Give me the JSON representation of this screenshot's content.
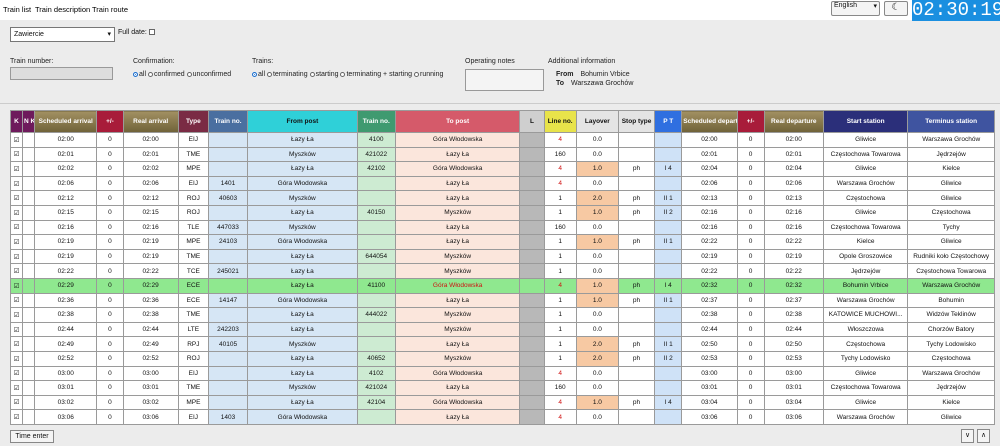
{
  "tabs": [
    "Train list",
    "Train description",
    "Train route"
  ],
  "language": "English",
  "clock": "02:30:19",
  "station": "Zawiercie",
  "full_date_label": "Full date:",
  "train_number_label": "Train number:",
  "confirmation": {
    "label": "Confirmation:",
    "options": [
      "all",
      "confirmed",
      "unconfirmed"
    ],
    "selected": "all"
  },
  "trains_filter": {
    "label": "Trains:",
    "options": [
      "all",
      "terminating",
      "starting",
      "terminating + starting",
      "running"
    ],
    "selected": "all"
  },
  "operating_notes_label": "Operating notes",
  "additional_info": {
    "label": "Additional information",
    "from_label": "From",
    "from_value": "Bohumin Vrbice",
    "to_label": "To",
    "to_value": "Warszawa Grochów"
  },
  "table": {
    "headers": {
      "k": "K",
      "nk": "N K",
      "sched_arr": "Scheduled arrival",
      "delay": "+/-",
      "real_arr": "Real arrival",
      "type": "Type",
      "train_no": "Train no.",
      "from_post": "From post",
      "train_no2": "Train no.",
      "to_post": "To post",
      "l": "L",
      "line": "Line no.",
      "layover": "Layover",
      "stop_type": "Stop type",
      "pt": "P T",
      "sched_dep": "Scheduled departure",
      "delay2": "+/-",
      "real_dep": "Real departure",
      "start": "Start station",
      "term": "Terminus station"
    },
    "rows": [
      {
        "k": "☑",
        "sa": "02:00",
        "d1": "0",
        "ra": "02:00",
        "type": "EIJ",
        "tn": "",
        "from": "Łazy Ła",
        "tn2": "4100",
        "to": "Góra Włodowska",
        "line": "4",
        "lay": "0.0",
        "stop": "",
        "pt": "",
        "sd": "02:00",
        "d2": "0",
        "rd": "02:00",
        "start": "Gliwice",
        "term": "Warszawa Grochów"
      },
      {
        "k": "☑",
        "sa": "02:01",
        "d1": "0",
        "ra": "02:01",
        "type": "TME",
        "tn": "",
        "from": "Myszków",
        "tn2": "421022",
        "to": "Łazy Ła",
        "line": "160",
        "lay": "0.0",
        "stop": "",
        "pt": "",
        "sd": "02:01",
        "d2": "0",
        "rd": "02:01",
        "start": "Częstochowa Towarowa",
        "term": "Jędrzejów"
      },
      {
        "k": "☑",
        "sa": "02:02",
        "d1": "0",
        "ra": "02:02",
        "type": "MPE",
        "tn": "",
        "from": "Łazy Ła",
        "tn2": "42102",
        "to": "Góra Włodowska",
        "line": "4",
        "lay": "1.0",
        "stop": "ph",
        "pt": "I 4",
        "sd": "02:04",
        "d2": "0",
        "rd": "02:04",
        "start": "Gliwice",
        "term": "Kielce"
      },
      {
        "k": "☑",
        "sa": "02:06",
        "d1": "0",
        "ra": "02:06",
        "type": "EIJ",
        "tn": "1401",
        "from": "Góra Włodowska",
        "tn2": "",
        "to": "Łazy Ła",
        "line": "4",
        "lay": "0.0",
        "stop": "",
        "pt": "",
        "sd": "02:06",
        "d2": "0",
        "rd": "02:06",
        "start": "Warszawa Grochów",
        "term": "Gliwice"
      },
      {
        "k": "☑",
        "sa": "02:12",
        "d1": "0",
        "ra": "02:12",
        "type": "ROJ",
        "tn": "40603",
        "from": "Myszków",
        "tn2": "",
        "to": "Łazy Ła",
        "line": "1",
        "lay": "2.0",
        "stop": "ph",
        "pt": "II 1",
        "sd": "02:13",
        "d2": "0",
        "rd": "02:13",
        "start": "Częstochowa",
        "term": "Gliwice"
      },
      {
        "k": "☑",
        "sa": "02:15",
        "d1": "0",
        "ra": "02:15",
        "type": "ROJ",
        "tn": "",
        "from": "Łazy Ła",
        "tn2": "40150",
        "to": "Myszków",
        "line": "1",
        "lay": "1.0",
        "stop": "ph",
        "pt": "II 2",
        "sd": "02:16",
        "d2": "0",
        "rd": "02:16",
        "start": "Gliwice",
        "term": "Częstochowa"
      },
      {
        "k": "☑",
        "sa": "02:16",
        "d1": "0",
        "ra": "02:16",
        "type": "TLE",
        "tn": "447033",
        "from": "Myszków",
        "tn2": "",
        "to": "Łazy Ła",
        "line": "160",
        "lay": "0.0",
        "stop": "",
        "pt": "",
        "sd": "02:16",
        "d2": "0",
        "rd": "02:16",
        "start": "Częstochowa Towarowa",
        "term": "Tychy"
      },
      {
        "k": "☑",
        "sa": "02:19",
        "d1": "0",
        "ra": "02:19",
        "type": "MPE",
        "tn": "24103",
        "from": "Góra Włodowska",
        "tn2": "",
        "to": "Łazy Ła",
        "line": "1",
        "lay": "1.0",
        "stop": "ph",
        "pt": "II 1",
        "sd": "02:22",
        "d2": "0",
        "rd": "02:22",
        "start": "Kielce",
        "term": "Gliwice"
      },
      {
        "k": "☑",
        "sa": "02:19",
        "d1": "0",
        "ra": "02:19",
        "type": "TME",
        "tn": "",
        "from": "Łazy Ła",
        "tn2": "644054",
        "to": "Myszków",
        "line": "1",
        "lay": "0.0",
        "stop": "",
        "pt": "",
        "sd": "02:19",
        "d2": "0",
        "rd": "02:19",
        "start": "Opole Groszowice",
        "term": "Rudniki koło Częstochowy"
      },
      {
        "k": "☑",
        "sa": "02:22",
        "d1": "0",
        "ra": "02:22",
        "type": "TCE",
        "tn": "245021",
        "from": "Łazy Ła",
        "tn2": "",
        "to": "Myszków",
        "line": "1",
        "lay": "0.0",
        "stop": "",
        "pt": "",
        "sd": "02:22",
        "d2": "0",
        "rd": "02:22",
        "start": "Jędrzejów",
        "term": "Częstochowa Towarowa"
      },
      {
        "k": "☑",
        "sa": "02:29",
        "d1": "0",
        "ra": "02:29",
        "type": "ECE",
        "tn": "",
        "from": "Łazy Ła",
        "tn2": "41100",
        "to": "Góra Włodowska",
        "line": "4",
        "lay": "1.0",
        "stop": "ph",
        "pt": "I 4",
        "sd": "02:32",
        "d2": "0",
        "rd": "02:32",
        "start": "Bohumin Vrbice",
        "term": "Warszawa Grochów",
        "active": true
      },
      {
        "k": "☑",
        "sa": "02:36",
        "d1": "0",
        "ra": "02:36",
        "type": "ECE",
        "tn": "14147",
        "from": "Góra Włodowska",
        "tn2": "",
        "to": "Łazy Ła",
        "line": "1",
        "lay": "1.0",
        "stop": "ph",
        "pt": "II 1",
        "sd": "02:37",
        "d2": "0",
        "rd": "02:37",
        "start": "Warszawa Grochów",
        "term": "Bohumin"
      },
      {
        "k": "☑",
        "sa": "02:38",
        "d1": "0",
        "ra": "02:38",
        "type": "TME",
        "tn": "",
        "from": "Łazy Ła",
        "tn2": "444022",
        "to": "Myszków",
        "line": "1",
        "lay": "0.0",
        "stop": "",
        "pt": "",
        "sd": "02:38",
        "d2": "0",
        "rd": "02:38",
        "start": "KATOWICE MUCHOWI...",
        "term": "Widzów Teklinów"
      },
      {
        "k": "☑",
        "sa": "02:44",
        "d1": "0",
        "ra": "02:44",
        "type": "LTE",
        "tn": "242203",
        "from": "Łazy Ła",
        "tn2": "",
        "to": "Myszków",
        "line": "1",
        "lay": "0.0",
        "stop": "",
        "pt": "",
        "sd": "02:44",
        "d2": "0",
        "rd": "02:44",
        "start": "Włoszczowa",
        "term": "Chorzów Batory"
      },
      {
        "k": "☑",
        "sa": "02:49",
        "d1": "0",
        "ra": "02:49",
        "type": "RPJ",
        "tn": "40105",
        "from": "Myszków",
        "tn2": "",
        "to": "Łazy Ła",
        "line": "1",
        "lay": "2.0",
        "stop": "ph",
        "pt": "II 1",
        "sd": "02:50",
        "d2": "0",
        "rd": "02:50",
        "start": "Częstochowa",
        "term": "Tychy Lodowisko"
      },
      {
        "k": "☑",
        "sa": "02:52",
        "d1": "0",
        "ra": "02:52",
        "type": "ROJ",
        "tn": "",
        "from": "Łazy Ła",
        "tn2": "40652",
        "to": "Myszków",
        "line": "1",
        "lay": "2.0",
        "stop": "ph",
        "pt": "II 2",
        "sd": "02:53",
        "d2": "0",
        "rd": "02:53",
        "start": "Tychy Lodowisko",
        "term": "Częstochowa"
      },
      {
        "k": "☑",
        "sa": "03:00",
        "d1": "0",
        "ra": "03:00",
        "type": "EIJ",
        "tn": "",
        "from": "Łazy Ła",
        "tn2": "4102",
        "to": "Góra Włodowska",
        "line": "4",
        "lay": "0.0",
        "stop": "",
        "pt": "",
        "sd": "03:00",
        "d2": "0",
        "rd": "03:00",
        "start": "Gliwice",
        "term": "Warszawa Grochów"
      },
      {
        "k": "☑",
        "sa": "03:01",
        "d1": "0",
        "ra": "03:01",
        "type": "TME",
        "tn": "",
        "from": "Myszków",
        "tn2": "421024",
        "to": "Łazy Ła",
        "line": "160",
        "lay": "0.0",
        "stop": "",
        "pt": "",
        "sd": "03:01",
        "d2": "0",
        "rd": "03:01",
        "start": "Częstochowa Towarowa",
        "term": "Jędrzejów"
      },
      {
        "k": "☑",
        "sa": "03:02",
        "d1": "0",
        "ra": "03:02",
        "type": "MPE",
        "tn": "",
        "from": "Łazy Ła",
        "tn2": "42104",
        "to": "Góra Włodowska",
        "line": "4",
        "lay": "1.0",
        "stop": "ph",
        "pt": "I 4",
        "sd": "03:04",
        "d2": "0",
        "rd": "03:04",
        "start": "Gliwice",
        "term": "Kielce"
      },
      {
        "k": "☑",
        "sa": "03:06",
        "d1": "0",
        "ra": "03:06",
        "type": "EIJ",
        "tn": "1403",
        "from": "Góra Włodowska",
        "tn2": "",
        "to": "Łazy Ła",
        "line": "4",
        "lay": "0.0",
        "stop": "",
        "pt": "",
        "sd": "03:06",
        "d2": "0",
        "rd": "03:06",
        "start": "Warszawa Grochów",
        "term": "Gliwice"
      }
    ]
  },
  "time_enter_label": "Time enter",
  "nav_down": "∨",
  "nav_up": "∧",
  "theme_icon": "moon-icon",
  "checkbox_glyph": "☑"
}
